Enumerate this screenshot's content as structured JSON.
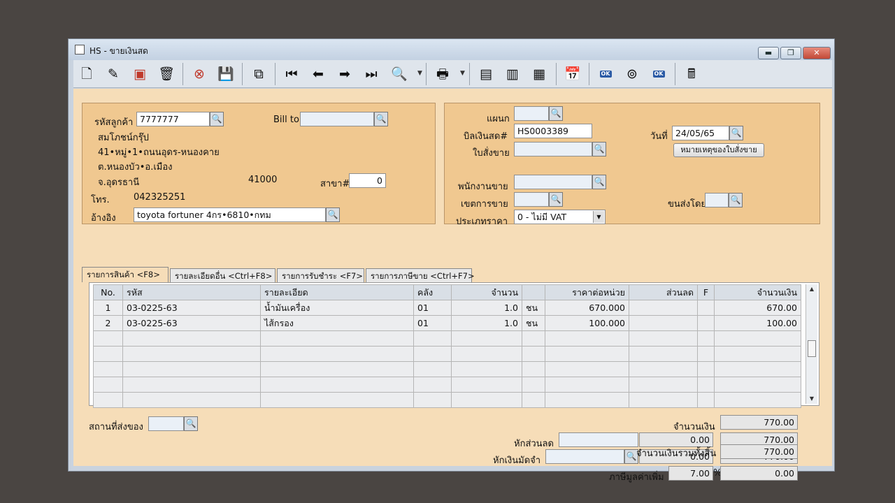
{
  "window": {
    "title": "HS - ขายเงินสด",
    "controls": {
      "minimize": "▬",
      "maximize": "❐",
      "close": "✕"
    }
  },
  "toolbar": {
    "icons": [
      "new-document-icon",
      "edit-icon",
      "delete-red-icon",
      "trash-can-icon",
      "cancel-icon",
      "save-icon",
      "copy-icon",
      "first-record-icon",
      "previous-record-icon",
      "next-record-icon",
      "last-record-icon",
      "find-icon",
      "print-icon",
      "report-icon",
      "export-icon",
      "import-icon",
      "calendar-icon",
      "approve-ok-icon",
      "search-binoculars-icon",
      "ok-icon",
      "calculator-icon"
    ]
  },
  "customer": {
    "code_label": "รหัสลูกค้า",
    "code": "7777777",
    "name": "สมโภชน์กรุ๊ป",
    "address_line1": "41•หมู่•1•ถนนอุดร-หนองคาย",
    "address_line2": "ต.หนองบัว•อ.เมือง",
    "address_line3": "จ.อุดรธานี",
    "postcode": "41000",
    "branch_label": "สาขา#",
    "branch": "0",
    "phone_label": "โทร.",
    "phone": "042325251",
    "reference_label": "อ้างอิง",
    "reference": "toyota fortuner 4กร•6810•กทม",
    "bill_to_label": "Bill to"
  },
  "document": {
    "department_label": "แผนก",
    "invoice_label": "บิลเงินสด#",
    "invoice_no": "HS0003389",
    "date_label": "วันที่",
    "date": "24/05/65",
    "sales_order_label": "ใบสั่งขาย",
    "sales_order_note_button": "หมายเหตุของใบสั่งขาย",
    "salesperson_label": "พนักงานขาย",
    "sales_area_label": "เขตการขาย",
    "shipping_label": "ขนส่งโดย",
    "price_type_label": "ประเภทราคา",
    "price_type": "0 - ไม่มี VAT"
  },
  "tabs": [
    {
      "label": "รายการสินค้า <F8>"
    },
    {
      "label": "รายละเอียดอื่น <Ctrl+F8>"
    },
    {
      "label": "รายการรับชำระ <F7>"
    },
    {
      "label": "รายการภาษีขาย <Ctrl+F7>"
    }
  ],
  "grid": {
    "columns": [
      "No.",
      "รหัส",
      "รายละเอียด",
      "คลัง",
      "จำนวน",
      "",
      "ราคาต่อหน่วย",
      "ส่วนลด",
      "F",
      "จำนวนเงิน"
    ],
    "rows": [
      {
        "no": "1",
        "code": "03-0225-63",
        "desc": "น้ำมันเครื่อง",
        "warehouse": "01",
        "qty": "1.0",
        "unit": "ชน",
        "price": "670.000",
        "discount": "",
        "f": "",
        "amount": "670.00"
      },
      {
        "no": "2",
        "code": "03-0225-63",
        "desc": "ไส้กรอง",
        "warehouse": "01",
        "qty": "1.0",
        "unit": "ชน",
        "price": "100.000",
        "discount": "",
        "f": "",
        "amount": "100.00"
      }
    ]
  },
  "footer": {
    "delivery_place_label": "สถานที่ส่งของ",
    "amount_label": "จำนวนเงิน",
    "amount": "770.00",
    "discount_label": "หักส่วนลด",
    "discount_value": "0.00",
    "after_discount": "770.00",
    "deposit_label": "หักเงินมัดจำ",
    "deposit_value": "0.00",
    "after_deposit": "770.00",
    "vat_label": "ภาษีมูลค่าเพิ่ม",
    "vat_rate": "7.00",
    "vat_percent_sign": "%",
    "vat_amount": "0.00",
    "total_label": "จำนวนเงินรวมทั้งสิ้น",
    "total": "770.00"
  }
}
